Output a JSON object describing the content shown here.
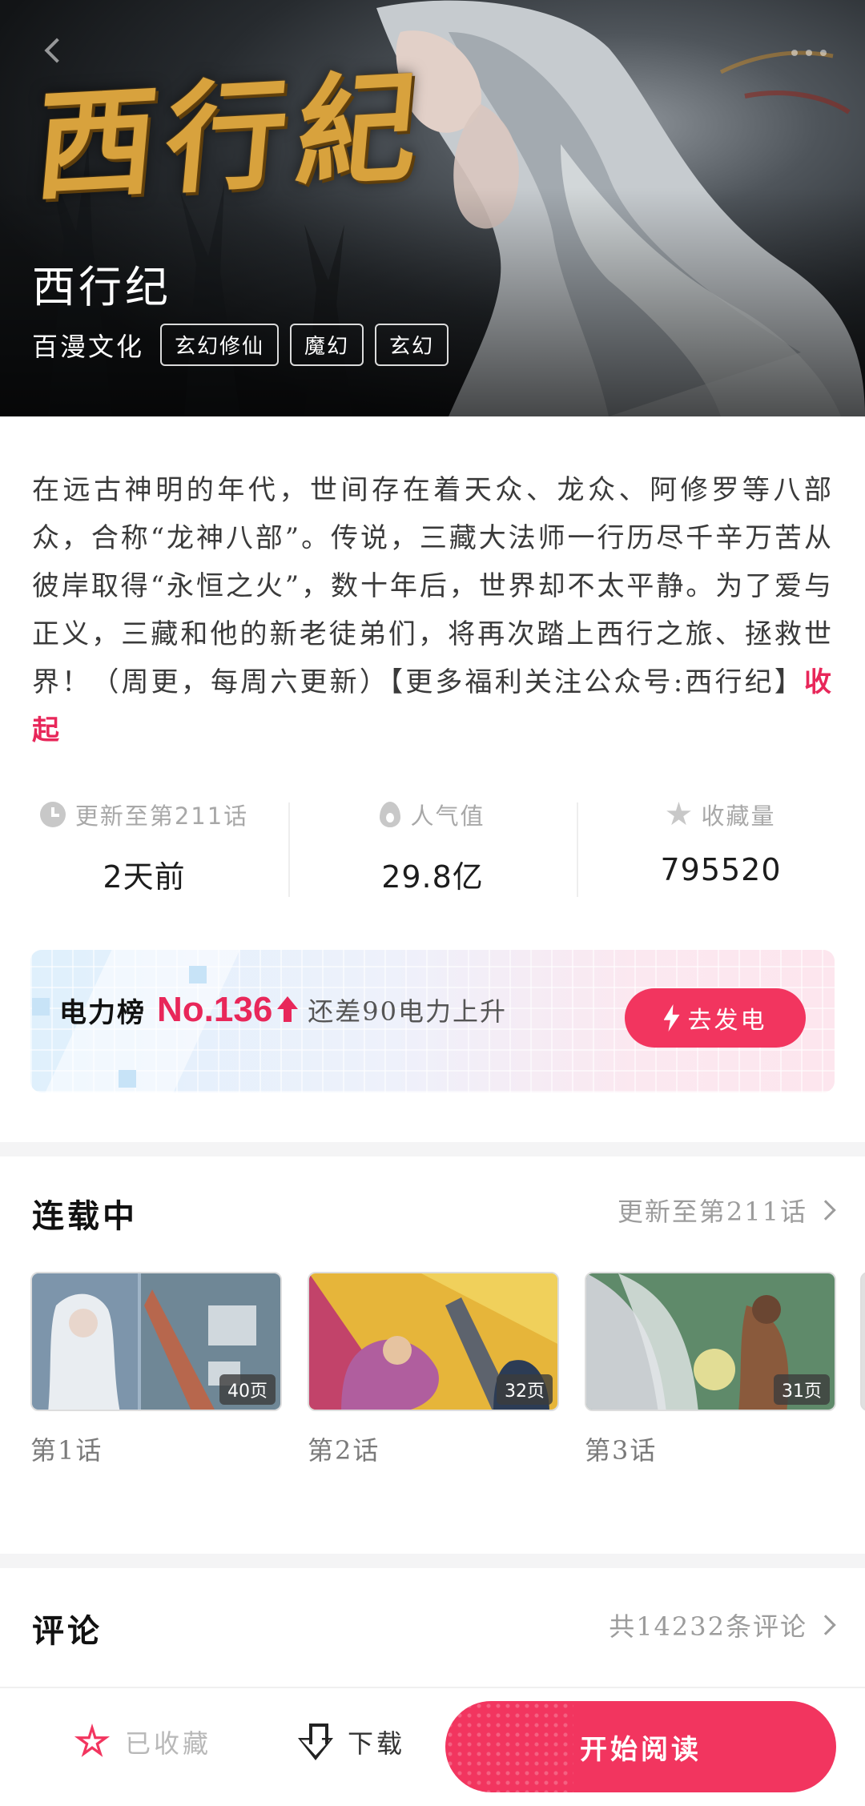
{
  "hero": {
    "logo_text": "西行紀",
    "title": "西行纪",
    "author": "百漫文化",
    "tags": [
      "玄幻修仙",
      "魔幻",
      "玄幻"
    ]
  },
  "description": {
    "text": "在远古神明的年代，世间存在着天众、龙众、阿修罗等八部众，合称“龙神八部”。传说，三藏大法师一行历尽千辛万苦从彼岸取得“永恒之火”，数十年后，世界却不太平静。为了爱与正义，三藏和他的新老徒弟们，将再次踏上西行之旅、拯救世界！（周更，每周六更新）【更多福利关注公众号:西行纪】",
    "collapse_label": "收起"
  },
  "stats": [
    {
      "icon": "clock-icon",
      "label": "更新至第211话",
      "value": "2天前"
    },
    {
      "icon": "flame-icon",
      "label": "人气值",
      "value": "29.8亿"
    },
    {
      "icon": "star-icon",
      "label": "收藏量",
      "value": "795520"
    }
  ],
  "power": {
    "label": "电力榜",
    "rank": "No.136",
    "desc": "还差90电力上升",
    "button_label": "去发电",
    "accent": "#e8275a"
  },
  "serial": {
    "title": "连载中",
    "more_label": "更新至第211话",
    "episodes": [
      {
        "title": "第1话",
        "pages": "40页"
      },
      {
        "title": "第2话",
        "pages": "32页"
      },
      {
        "title": "第3话",
        "pages": "31页"
      }
    ]
  },
  "comments": {
    "title": "评论",
    "more_label": "共14232条评论"
  },
  "bottom": {
    "fav_label": "已收藏",
    "download_label": "下载",
    "read_label": "开始阅读",
    "accent": "#f2355f"
  }
}
